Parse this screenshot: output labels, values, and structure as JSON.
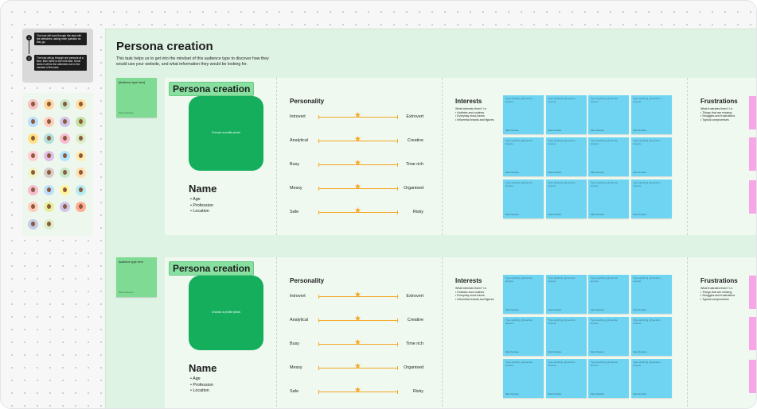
{
  "instructions": {
    "steps": [
      {
        "num": "1",
        "text": "The host will work through this task with the attendees, asking each question as they go."
      },
      {
        "num": "2",
        "text": "The host will go through one persona at a time, then move to the next task. Some times it will be the attendees are in the mindset of this task."
      }
    ]
  },
  "board": {
    "title": "Persona creation",
    "subtitle": "This task helps us to get into the mindset of this audience type to discover how they would use your website, and what information they would be looking for."
  },
  "personas": [
    {
      "audience_sticky": "[Audience type here]",
      "audience_author": "Name Surname",
      "tag": "Persona creation",
      "photo_label": "Choose a profile photo",
      "name": "Name",
      "details": [
        "Age",
        "Profession",
        "Location"
      ],
      "personality_title": "Personality",
      "sliders": [
        {
          "left": "Introvert",
          "right": "Extrovert",
          "value": 0.5
        },
        {
          "left": "Analytical",
          "right": "Creative",
          "value": 0.5
        },
        {
          "left": "Busy",
          "right": "Time rich",
          "value": 0.5
        },
        {
          "left": "Messy",
          "right": "Organised",
          "value": 0.5
        },
        {
          "left": "Safe",
          "right": "Risky",
          "value": 0.5
        }
      ],
      "interests_title": "Interests",
      "interests_hint": [
        "What interests them? i.e.",
        "• Hobbies and routines",
        "• Everyday must-haves",
        "• Influential brands and figures"
      ],
      "frustrations_title": "Frustrations",
      "frustrations_hint": [
        "What frustrates them? i.e.",
        "• Things that are missing",
        "• Struggles and frustrations",
        "• Typical compromises"
      ]
    },
    {
      "audience_sticky": "Audience type here",
      "audience_author": "Name Surname",
      "tag": "Persona creation",
      "photo_label": "Choose a profile photo",
      "name": "Name",
      "details": [
        "Age",
        "Profession",
        "Location"
      ],
      "personality_title": "Personality",
      "sliders": [
        {
          "left": "Introvert",
          "right": "Extrovert",
          "value": 0.5
        },
        {
          "left": "Analytical",
          "right": "Creative",
          "value": 0.5
        },
        {
          "left": "Busy",
          "right": "Time rich",
          "value": 0.5
        },
        {
          "left": "Messy",
          "right": "Organised",
          "value": 0.5
        },
        {
          "left": "Safe",
          "right": "Risky",
          "value": 0.5
        }
      ],
      "interests_title": "Interests",
      "interests_hint": [
        "What interests them? i.e.",
        "• Hobbies and routines",
        "• Everyday must-haves",
        "• Influential brands and figures"
      ],
      "frustrations_title": "Frustrations",
      "frustrations_hint": [
        "What frustrates them? i.e.",
        "• Things that are missing",
        "• Struggles and frustrations",
        "• Typical compromises"
      ]
    }
  ],
  "sticky_note": {
    "text": "Type anything, @mention anyone",
    "author": "Name Surname"
  },
  "colors": {
    "board_bg": "#dff3e4",
    "panel_bg": "#eff9f0",
    "photo_green": "#14ae5c",
    "sticky_green": "#7fdb93",
    "sticky_blue": "#6ed4f2",
    "sticky_pink": "#f7a6e8",
    "slider_orange": "#f5a623"
  },
  "avatar_colors": [
    "#f4c2c2",
    "#ffd59e",
    "#c8e6c9",
    "#ffe0a3",
    "#bbdefb",
    "#ffccbc",
    "#d1c4e9",
    "#c5e1a5",
    "#ffe082",
    "#b2dfdb",
    "#f8bbd0",
    "#dcedc8",
    "#ffcdd2",
    "#e1bee7",
    "#b3e5fc",
    "#ffecb3",
    "#f0f4c3",
    "#d7ccc8",
    "#c8e6c9",
    "#ffe0b2",
    "#f8bbd0",
    "#bbdefb",
    "#fff59d",
    "#b2ebf2",
    "#ffccbc",
    "#e6ee9c",
    "#d1c4e9",
    "#ffab91",
    "#c5cae9",
    "#dcedc8"
  ]
}
